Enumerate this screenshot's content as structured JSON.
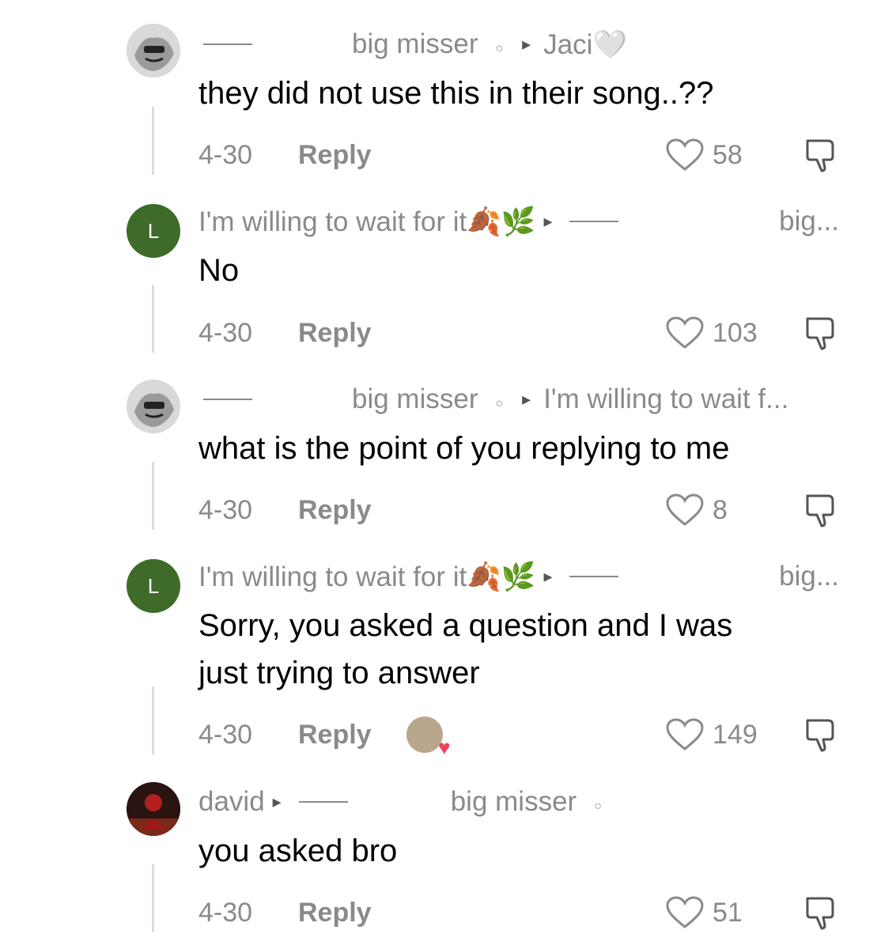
{
  "comments": [
    {
      "avatar": {
        "type": "sketch"
      },
      "author": "big misser",
      "arrow": "▸",
      "reply_to": "Jaci🤍",
      "text_lines": [
        "they did not use this in their song..??"
      ],
      "date": "4-30",
      "reply_label": "Reply",
      "likes": "58"
    },
    {
      "avatar": {
        "type": "letter",
        "letter": "L"
      },
      "author": "I'm willing to wait for it🍂🌿",
      "arrow": "▸",
      "reply_to": "big...",
      "text_lines": [
        "No"
      ],
      "date": "4-30",
      "reply_label": "Reply",
      "likes": "103"
    },
    {
      "avatar": {
        "type": "sketch"
      },
      "author": "big misser",
      "arrow": "▸",
      "reply_to": "I'm willing to wait f...",
      "text_lines": [
        "what is the point of you replying to me"
      ],
      "date": "4-30",
      "reply_label": "Reply",
      "likes": "8"
    },
    {
      "avatar": {
        "type": "letter",
        "letter": "L"
      },
      "author": "I'm willing to wait for it🍂🌿",
      "arrow": "▸",
      "reply_to": "big...",
      "text_lines": [
        "Sorry, you asked a question and I was",
        "just trying to answer"
      ],
      "date": "4-30",
      "reply_label": "Reply",
      "likes": "149",
      "creator_liked": true
    },
    {
      "avatar": {
        "type": "dark"
      },
      "author": "david",
      "arrow": "▸",
      "reply_to": "big misser",
      "text_lines": [
        "you asked bro"
      ],
      "date": "4-30",
      "reply_label": "Reply",
      "likes": "51"
    }
  ],
  "colors": {
    "meta_gray": "#8a8a8a",
    "letter_avatar": "#3f6b2a",
    "heart": "#f0425a"
  }
}
